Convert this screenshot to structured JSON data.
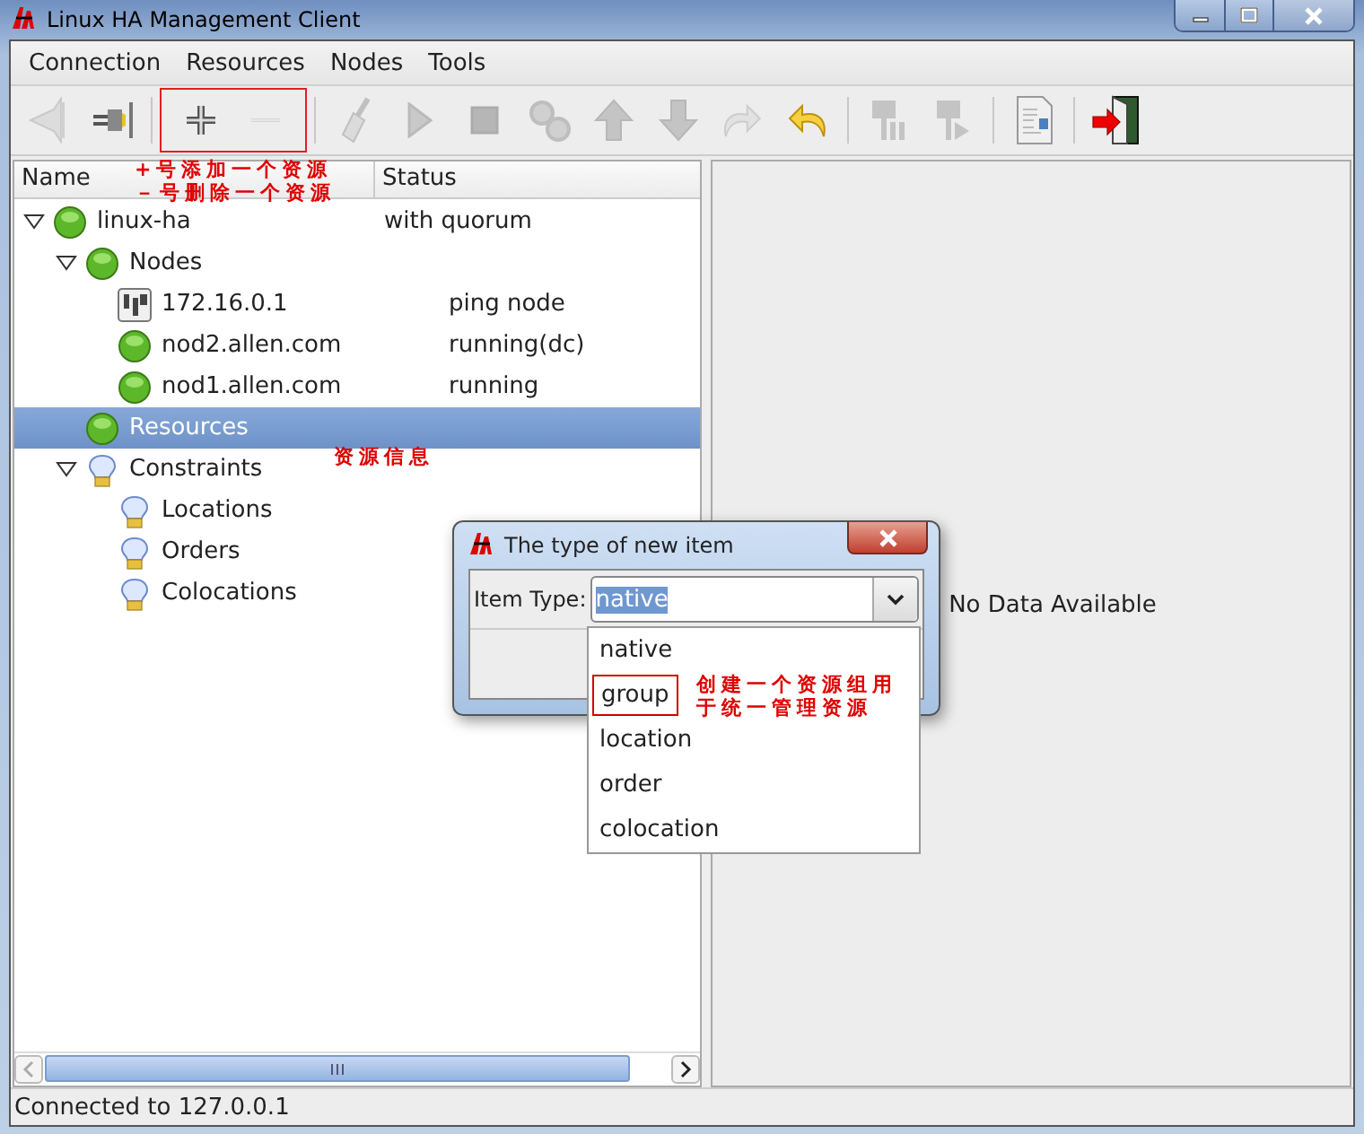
{
  "window": {
    "title": "Linux HA Management Client"
  },
  "menu": [
    "Connection",
    "Resources",
    "Nodes",
    "Tools"
  ],
  "toolbar": [
    {
      "highlighted": false,
      "items": [
        {
          "kind": "disconnect",
          "disabled": true
        },
        {
          "kind": "connect",
          "disabled": false
        }
      ]
    },
    {
      "highlighted": true,
      "items": [
        {
          "kind": "add",
          "disabled": false
        },
        {
          "kind": "remove",
          "disabled": true
        }
      ]
    },
    {
      "highlighted": false,
      "items": [
        {
          "kind": "cleanup",
          "disabled": true
        },
        {
          "kind": "start",
          "disabled": true
        },
        {
          "kind": "stop",
          "disabled": true
        },
        {
          "kind": "gears",
          "disabled": true
        },
        {
          "kind": "up",
          "disabled": true
        },
        {
          "kind": "down",
          "disabled": true
        },
        {
          "kind": "redo",
          "disabled": true
        },
        {
          "kind": "undo",
          "disabled": false
        }
      ]
    },
    {
      "highlighted": false,
      "items": [
        {
          "kind": "standby",
          "disabled": true
        },
        {
          "kind": "active",
          "disabled": true
        }
      ]
    },
    {
      "highlighted": false,
      "items": [
        {
          "kind": "document",
          "disabled": false
        }
      ]
    },
    {
      "highlighted": false,
      "items": [
        {
          "kind": "exit",
          "disabled": false
        }
      ]
    }
  ],
  "tree": {
    "columns": [
      "Name",
      "Status"
    ],
    "rows": [
      {
        "name": "linux-ha",
        "status": "with quorum",
        "kind": "ball",
        "expanded": true,
        "selected": false,
        "children": [
          {
            "name": "Nodes",
            "kind": "ball",
            "expanded": true,
            "selected": false,
            "children": [
              {
                "name": "172.16.0.1",
                "status": "ping node",
                "kind": "ping",
                "selected": false
              },
              {
                "name": "nod2.allen.com",
                "status": "running(dc)",
                "kind": "ball",
                "selected": false
              },
              {
                "name": "nod1.allen.com",
                "status": "running",
                "kind": "ball",
                "selected": false
              }
            ]
          },
          {
            "name": "Resources",
            "kind": "ball",
            "selected": true
          },
          {
            "name": "Constraints",
            "kind": "bulb",
            "expanded": true,
            "selected": false,
            "children": [
              {
                "name": "Locations",
                "kind": "bulb",
                "selected": false
              },
              {
                "name": "Orders",
                "kind": "bulb",
                "selected": false
              },
              {
                "name": "Colocations",
                "kind": "bulb",
                "selected": false
              }
            ]
          }
        ]
      }
    ]
  },
  "detail": {
    "message": "No Data Available"
  },
  "status_bar": "Connected to 127.0.0.1",
  "dialog": {
    "title": "The type of new item",
    "label": "Item Type:",
    "value": "native",
    "options": [
      {
        "label": "native",
        "highlighted": false
      },
      {
        "label": "group",
        "highlighted": true
      },
      {
        "label": "location",
        "highlighted": false
      },
      {
        "label": "order",
        "highlighted": false
      },
      {
        "label": "colocation",
        "highlighted": false
      }
    ]
  },
  "annotations": [
    {
      "kind": "toolbar",
      "lines": [
        "+号添加一个资源",
        "－号删除一个资源"
      ]
    },
    {
      "kind": "tree",
      "lines": [
        "资源信息"
      ]
    },
    {
      "kind": "dropdown",
      "lines": [
        "创建一个资源组用",
        "于统一管理资源"
      ]
    }
  ]
}
